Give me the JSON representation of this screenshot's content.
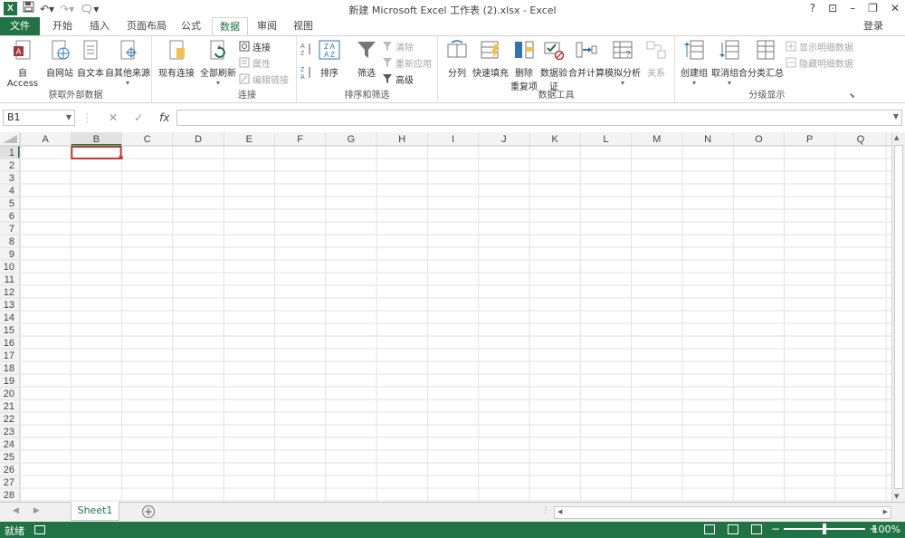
{
  "titlebar": {
    "title": "新建 Microsoft Excel 工作表 (2).xlsx - Excel",
    "logo": "X",
    "help": "?",
    "ribbon_display": "⊡",
    "minimize": "–",
    "restore": "❐",
    "close": "✕"
  },
  "tabs": [
    "文件",
    "开始",
    "插入",
    "页面布局",
    "公式",
    "数据",
    "审阅",
    "视图"
  ],
  "active_tab": "数据",
  "login": "登录",
  "ribbon": {
    "groups": {
      "external": "获取外部数据",
      "connections": "连接",
      "sort_filter": "排序和筛选",
      "data_tools": "数据工具",
      "outline": "分级显示"
    },
    "buttons": {
      "from_access": "自 Access",
      "from_web": "自网站",
      "from_text": "自文本",
      "from_other": "自其他来源",
      "existing_conn": "现有连接",
      "refresh_all": "全部刷新",
      "connections": "连接",
      "properties": "属性",
      "edit_links": "编辑链接",
      "sort": "排序",
      "filter": "筛选",
      "clear": "清除",
      "reapply": "重新应用",
      "advanced": "高级",
      "text_to_columns": "分列",
      "flash_fill": "快速填充",
      "remove_dup_1": "删除",
      "remove_dup_2": "重复项",
      "validation_1": "数据验",
      "validation_2": "证",
      "consolidate": "合并计算",
      "whatif": "模拟分析",
      "relationships": "关系",
      "group": "创建组",
      "ungroup": "取消组合",
      "subtotal": "分类汇总",
      "show_detail": "显示明细数据",
      "hide_detail": "隐藏明细数据"
    }
  },
  "formula_bar": {
    "name_box": "B1",
    "fx": "fx",
    "cancel": "✕",
    "enter": "✓",
    "value": ""
  },
  "grid": {
    "columns": [
      "A",
      "B",
      "C",
      "D",
      "E",
      "F",
      "G",
      "H",
      "I",
      "J",
      "K",
      "L",
      "M",
      "N",
      "O",
      "P",
      "Q"
    ],
    "row_count": 28,
    "selected_cell": "B1"
  },
  "sheets": [
    "Sheet1"
  ],
  "status": {
    "ready": "就绪",
    "zoom_minus": "−",
    "zoom_plus": "+",
    "zoom": "100%",
    "zoom_level": 1.0
  },
  "colors": {
    "accent": "#217346",
    "selection": "#c0392b"
  }
}
